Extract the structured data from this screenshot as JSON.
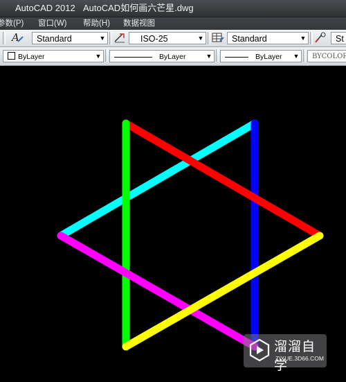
{
  "window": {
    "app_title": "AutoCAD 2012",
    "document_title": "AutoCAD如何画六芒星.dwg"
  },
  "menu": {
    "items": [
      "参数(P)",
      "窗口(W)",
      "帮助(H)",
      "数据视图"
    ]
  },
  "toolbar1": {
    "text_style": "Standard",
    "dim_style": "ISO-25",
    "table_style": "Standard",
    "mleader_style": "St"
  },
  "toolbar2": {
    "color": "ByLayer",
    "linetype": "ByLayer",
    "lineweight": "ByLayer",
    "plot_style": "BYCOLOR"
  },
  "drawing": {
    "segments": [
      {
        "name": "red",
        "color": "#ff0000"
      },
      {
        "name": "cyan",
        "color": "#00ffff"
      },
      {
        "name": "blue",
        "color": "#0000ff"
      },
      {
        "name": "green",
        "color": "#00ff00"
      },
      {
        "name": "magenta",
        "color": "#ff00ff"
      },
      {
        "name": "yellow",
        "color": "#ffff00"
      }
    ]
  },
  "watermark": {
    "name": "溜溜自学",
    "url": "ZIXUE.3D66.COM"
  }
}
